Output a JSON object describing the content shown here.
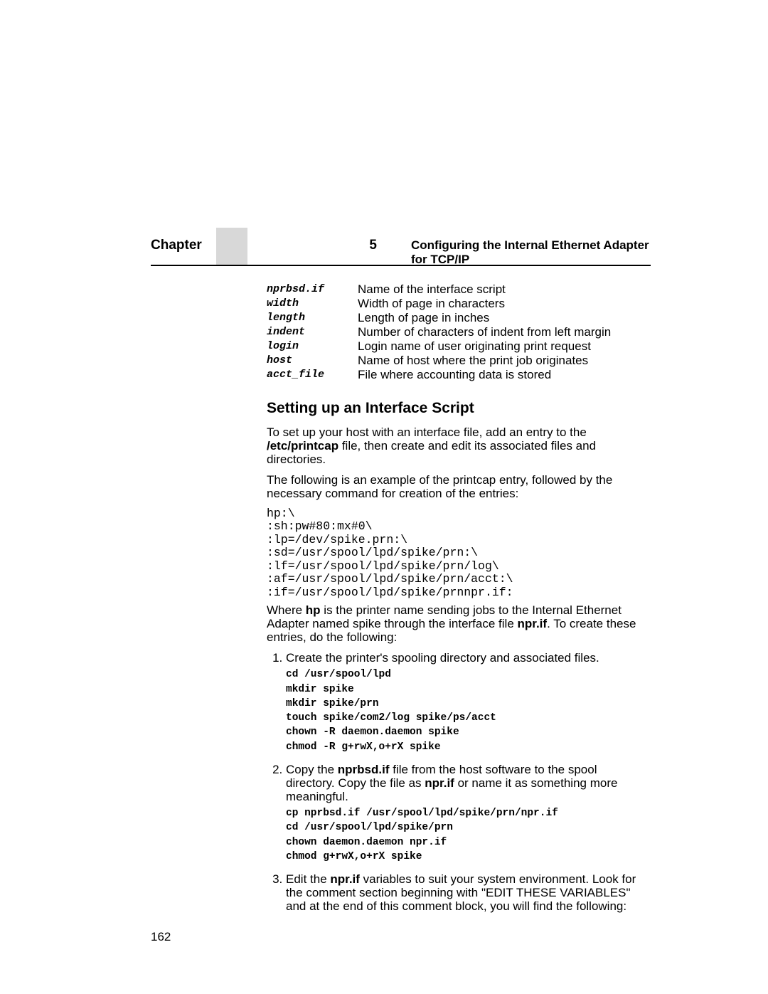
{
  "header": {
    "chapter_label": "Chapter",
    "chapter_num": "5",
    "chapter_title": "Configuring the Internal Ethernet Adapter for TCP/IP"
  },
  "defs": [
    {
      "term": "nprbsd.if",
      "desc": "Name of the interface script"
    },
    {
      "term": "width",
      "desc": "Width of page in characters"
    },
    {
      "term": "length",
      "desc": "Length of page in inches"
    },
    {
      "term": "indent",
      "desc": "Number of characters of indent from left margin"
    },
    {
      "term": "login",
      "desc": "Login name of user originating print request"
    },
    {
      "term": "host",
      "desc": "Name of host where the print job originates"
    },
    {
      "term": "acct_file",
      "desc": "File where accounting data is stored"
    }
  ],
  "section_title": "Setting up an Interface Script",
  "paras": {
    "p1_pre": "To set up your host with an interface file, add an entry to the ",
    "p1_bold1": "/etc/printcap",
    "p1_post": " file, then create and edit its associated files and directories.",
    "p2": "The following is an example of the printcap entry, followed by the necessary command for creation of the entries:",
    "p3_pre": "Where ",
    "p3_b1": "hp",
    "p3_mid1": " is the printer name sending jobs to the Internal Ethernet Adapter named spike through the interface file ",
    "p3_b2": "npr.if",
    "p3_post": ". To create these entries, do the following:"
  },
  "printcap": "hp:\\\n:sh:pw#80:mx#0\\\n:lp=/dev/spike.prn:\\\n:sd=/usr/spool/lpd/spike/prn:\\\n:lf=/usr/spool/lpd/spike/prn/log\\\n:af=/usr/spool/lpd/spike/prn/acct:\\\n:if=/usr/spool/lpd/spike/prnnpr.if:",
  "steps": {
    "s1_text": "Create the printer's spooling directory and associated files.",
    "s1_code": "cd /usr/spool/lpd\nmkdir spike\nmkdir spike/prn\ntouch spike/com2/log spike/ps/acct\nchown -R daemon.daemon spike\nchmod -R g+rwX,o+rX spike",
    "s2_pre": "Copy the ",
    "s2_b1": "nprbsd.if",
    "s2_mid1": " file from the host software to the spool directory. Copy the file as ",
    "s2_b2": "npr.if",
    "s2_post": " or name it as something more meaningful.",
    "s2_code": "cp nprbsd.if /usr/spool/lpd/spike/prn/npr.if\ncd /usr/spool/lpd/spike/prn\nchown daemon.daemon npr.if\nchmod g+rwX,o+rX spike",
    "s3_pre": "Edit the ",
    "s3_b1": "npr.if",
    "s3_post": " variables to suit your system environment. Look for the comment section beginning with \"EDIT THESE VARIABLES\" and at the end of this comment block, you will find the following:"
  },
  "page_number": "162"
}
